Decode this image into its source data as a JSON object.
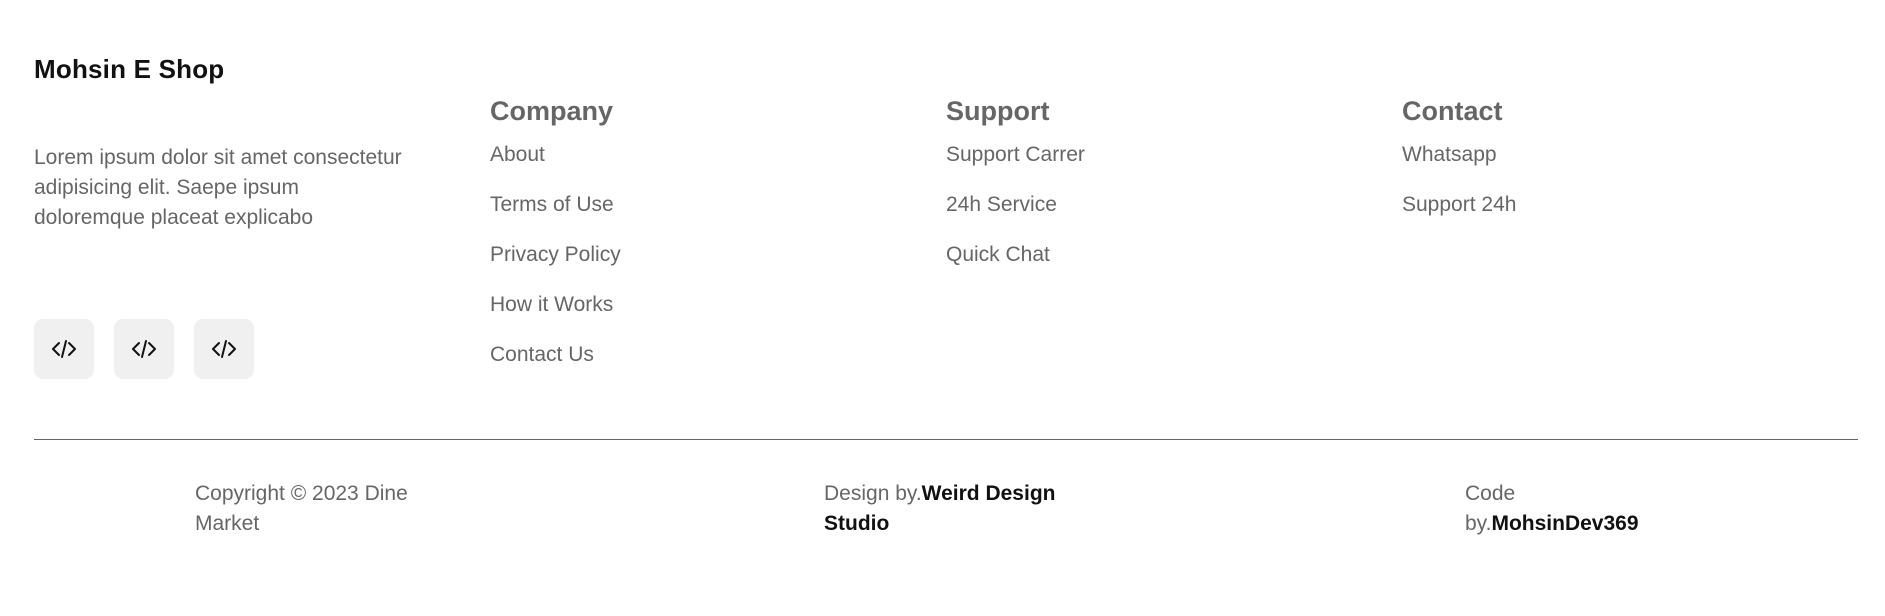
{
  "brand": {
    "name": "Mohsin E Shop"
  },
  "about": {
    "description": "Lorem ipsum dolor sit amet consectetur adipisicing elit. Saepe ipsum doloremque placeat explicabo"
  },
  "socials": [
    {
      "icon": "code-icon"
    },
    {
      "icon": "code-icon"
    },
    {
      "icon": "code-icon"
    }
  ],
  "columns": {
    "company": {
      "title": "Company",
      "links": [
        "About",
        "Terms of Use",
        "Privacy Policy",
        "How it Works",
        "Contact Us"
      ]
    },
    "support": {
      "title": "Support",
      "links": [
        "Support Carrer",
        "24h Service",
        "Quick Chat"
      ]
    },
    "contact": {
      "title": "Contact",
      "links": [
        "Whatsapp",
        "Support 24h"
      ]
    }
  },
  "bottom": {
    "copyright": "Copyright © 2023 Dine Market",
    "design_prefix": "Design by.",
    "design_name": "Weird Design Studio",
    "code_prefix": "Code by.",
    "code_name": "MohsinDev369"
  },
  "colors": {
    "text": "#666666",
    "heading": "#111111",
    "icon_bg": "#f0f0f0"
  }
}
